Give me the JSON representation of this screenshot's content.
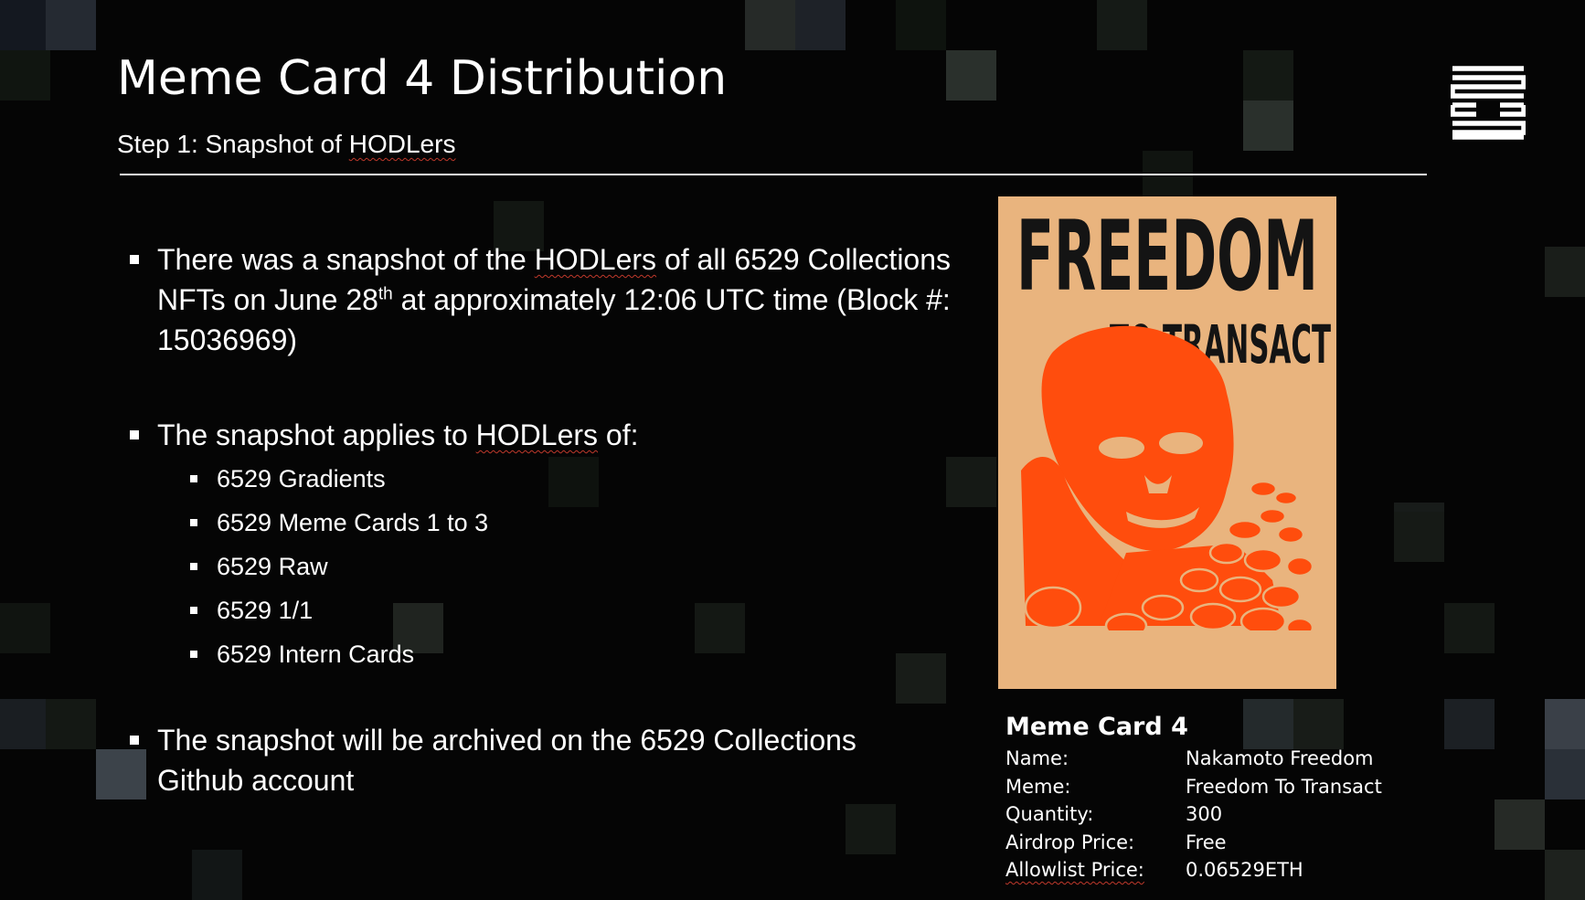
{
  "slide": {
    "title": "Meme Card 4 Distribution",
    "subtitle_prefix": "Step 1: Snapshot of ",
    "subtitle_term": "HODLers",
    "logo_icon": "6529-logo-icon",
    "bullets": {
      "b1_a": "There was a snapshot of the ",
      "b1_term": "HODLers",
      "b1_b": " of all 6529 Collections NFTs on June 28",
      "b1_sup": "th",
      "b1_c": " at approximately 12:06 UTC time (Block #: 15036969)",
      "b2_a": "The snapshot applies to ",
      "b2_term": "HODLers",
      "b2_b": " of:",
      "sub": [
        "6529 Gradients",
        "6529 Meme Cards 1 to 3",
        "6529 Raw",
        "6529 1/1",
        "6529 Intern Cards"
      ],
      "b3": "The snapshot will be archived on the 6529 Collections Github account"
    },
    "artwork": {
      "line1": "FREEDOM",
      "line2": "TO TRANSACT",
      "background": "#e9b47e",
      "ink": "#ff4d0d",
      "text_color": "#141414"
    },
    "card_info": {
      "title": "Meme Card 4",
      "rows": [
        {
          "label": "Name:",
          "value": "Nakamoto Freedom"
        },
        {
          "label": "Meme:",
          "value": "Freedom To Transact"
        },
        {
          "label": "Quantity:",
          "value": "300"
        },
        {
          "label": "Airdrop Price:",
          "value": "Free"
        },
        {
          "label": "Allowlist Price:",
          "value": "0.06529ETH"
        }
      ]
    }
  }
}
